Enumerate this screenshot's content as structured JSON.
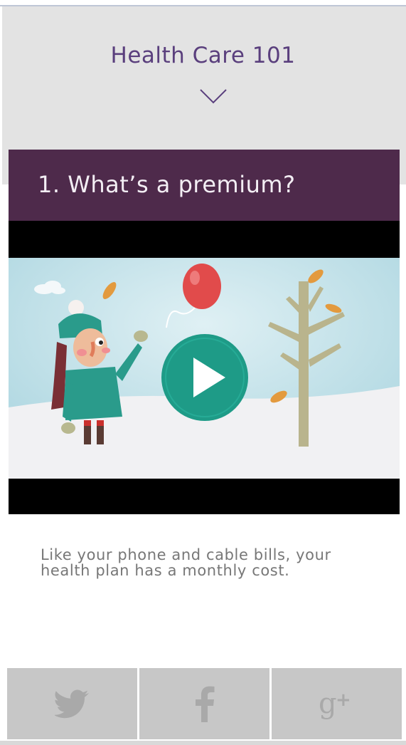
{
  "header": {
    "title": "Health Care 101"
  },
  "question": {
    "title": "1. What’s a premium?"
  },
  "video": {
    "play_icon": "play-icon"
  },
  "description": {
    "text": "Like your phone and cable bills, your health plan has a monthly cost."
  },
  "share": {
    "items": [
      {
        "icon": "twitter-icon"
      },
      {
        "icon": "facebook-icon"
      },
      {
        "icon": "google-plus-icon"
      }
    ]
  },
  "colors": {
    "header_text": "#5a3f7d",
    "question_bar": "#4e2a4b",
    "play_button": "#1e9b87",
    "share_button": "#c7c7c7"
  }
}
